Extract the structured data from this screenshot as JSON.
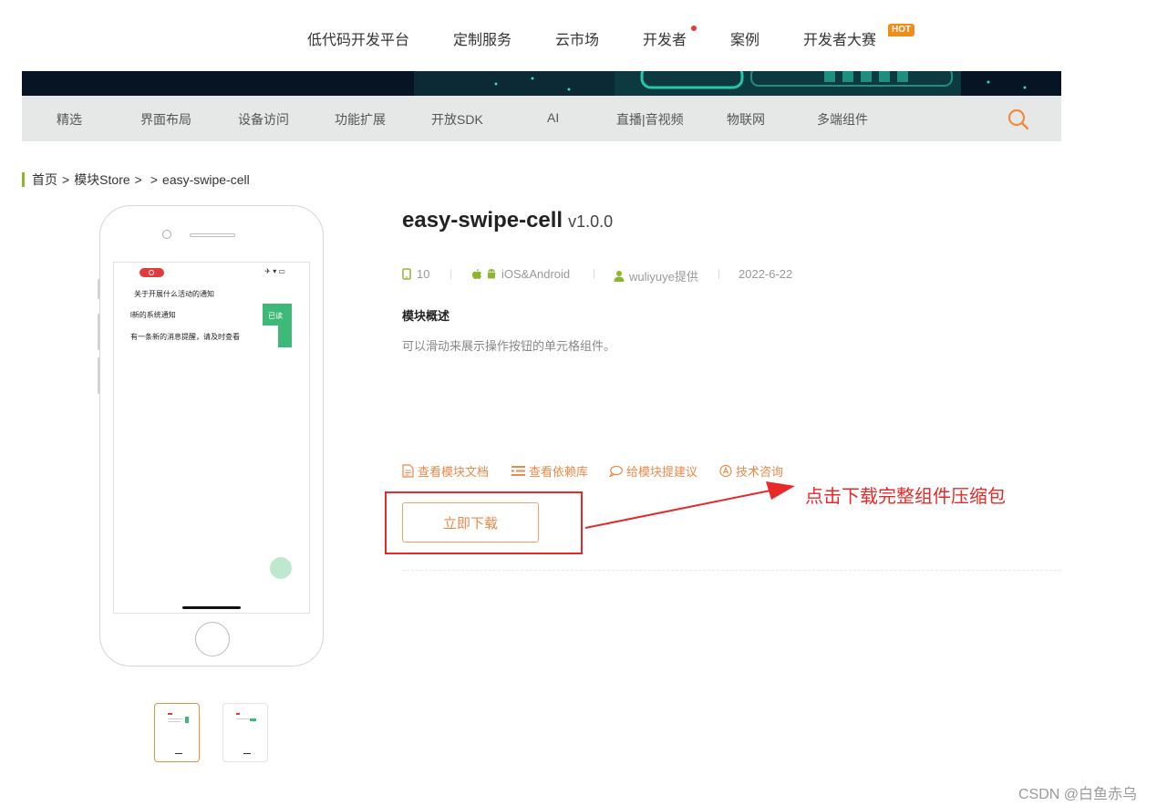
{
  "topnav": {
    "items": [
      "低代码开发平台",
      "定制服务",
      "云市场",
      "开发者",
      "案例",
      "开发者大赛"
    ],
    "hot_badge": "HOT"
  },
  "catbar": {
    "items": [
      "精选",
      "界面布局",
      "设备访问",
      "功能扩展",
      "开放SDK",
      "AI",
      "直播|音视频",
      "物联网",
      "多端组件"
    ],
    "search_icon": "search-icon"
  },
  "breadcrumb": {
    "home": "首页",
    "store": "模块Store",
    "sep": ">",
    "current": "easy-swipe-cell"
  },
  "preview": {
    "screen_lines": [
      "关于开展什么活动的通知",
      "l新的系统通知",
      "有一条新的消息提醒，请及时查看"
    ],
    "swipe_label": "已读"
  },
  "module": {
    "name": "easy-swipe-cell",
    "version": "v1.0.0",
    "downloads": "10",
    "platform": "iOS&Android",
    "provider": "wuliyuye提供",
    "date": "2022-6-22",
    "overview_title": "模块概述",
    "description": "可以滑动来展示操作按钮的单元格组件。"
  },
  "links": {
    "docs": "查看模块文档",
    "deps": "查看依赖库",
    "feedback": "给模块提建议",
    "support": "技术咨询"
  },
  "download_button": "立即下载",
  "annotation": "点击下载完整组件压缩包",
  "watermark": "CSDN @白鱼赤乌",
  "colors": {
    "accent_orange": "#e98a4a",
    "accent_green": "#8fb42e",
    "annotation_red": "#e82929"
  }
}
